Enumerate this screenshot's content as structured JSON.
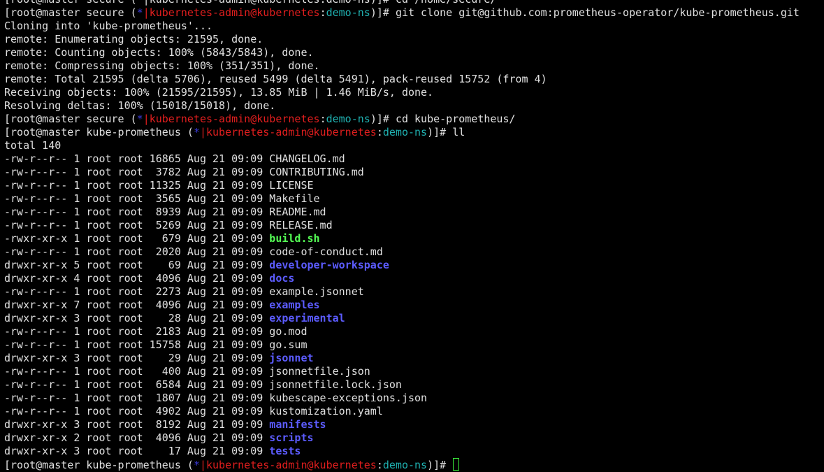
{
  "colors": {
    "background": "#000000",
    "text": "#e0e0e0",
    "prompt_marker": "#3a3ad6",
    "kube_user": "#e01e1e",
    "kube_namespace": "#1fb1b1",
    "executable": "#55ff55",
    "directory": "#5c5cff",
    "cursor": "#39e639"
  },
  "terminal": {
    "first_line_partial": "[root@master secure (*|kubernetes-admin@kubernetes:demo-ns)]# cd /home/secure/",
    "prompt_user_host": "[root@master ",
    "prompt_marker": "*",
    "prompt_kube_user": "kubernetes-admin@kubernetes",
    "prompt_namespace": "demo-ns",
    "prompt_end": ")]# ",
    "cmd_clone": {
      "dir": "secure",
      "command": "git clone git@github.com:prometheus-operator/kube-prometheus.git"
    },
    "clone_output": [
      "Cloning into 'kube-prometheus'...",
      "remote: Enumerating objects: 21595, done.",
      "remote: Counting objects: 100% (5843/5843), done.",
      "remote: Compressing objects: 100% (351/351), done.",
      "remote: Total 21595 (delta 5706), reused 5499 (delta 5491), pack-reused 15752 (from 4)",
      "Receiving objects: 100% (21595/21595), 13.85 MiB | 1.46 MiB/s, done.",
      "Resolving deltas: 100% (15018/15018), done."
    ],
    "cmd_cd": {
      "dir": "secure",
      "command": "cd kube-prometheus/"
    },
    "cmd_ll": {
      "dir": "kube-prometheus",
      "command": "ll"
    },
    "total_line": "total 140",
    "listing": [
      {
        "meta": "-rw-r--r-- 1 root root 16865 Aug 21 09:09 ",
        "name": "CHANGELOG.md",
        "kind": "file"
      },
      {
        "meta": "-rw-r--r-- 1 root root  3782 Aug 21 09:09 ",
        "name": "CONTRIBUTING.md",
        "kind": "file"
      },
      {
        "meta": "-rw-r--r-- 1 root root 11325 Aug 21 09:09 ",
        "name": "LICENSE",
        "kind": "file"
      },
      {
        "meta": "-rw-r--r-- 1 root root  3565 Aug 21 09:09 ",
        "name": "Makefile",
        "kind": "file"
      },
      {
        "meta": "-rw-r--r-- 1 root root  8939 Aug 21 09:09 ",
        "name": "README.md",
        "kind": "file"
      },
      {
        "meta": "-rw-r--r-- 1 root root  5269 Aug 21 09:09 ",
        "name": "RELEASE.md",
        "kind": "file"
      },
      {
        "meta": "-rwxr-xr-x 1 root root   679 Aug 21 09:09 ",
        "name": "build.sh",
        "kind": "exec"
      },
      {
        "meta": "-rw-r--r-- 1 root root  2020 Aug 21 09:09 ",
        "name": "code-of-conduct.md",
        "kind": "file"
      },
      {
        "meta": "drwxr-xr-x 5 root root    69 Aug 21 09:09 ",
        "name": "developer-workspace",
        "kind": "dir"
      },
      {
        "meta": "drwxr-xr-x 4 root root  4096 Aug 21 09:09 ",
        "name": "docs",
        "kind": "dir"
      },
      {
        "meta": "-rw-r--r-- 1 root root  2273 Aug 21 09:09 ",
        "name": "example.jsonnet",
        "kind": "file"
      },
      {
        "meta": "drwxr-xr-x 7 root root  4096 Aug 21 09:09 ",
        "name": "examples",
        "kind": "dir"
      },
      {
        "meta": "drwxr-xr-x 3 root root    28 Aug 21 09:09 ",
        "name": "experimental",
        "kind": "dir"
      },
      {
        "meta": "-rw-r--r-- 1 root root  2183 Aug 21 09:09 ",
        "name": "go.mod",
        "kind": "file"
      },
      {
        "meta": "-rw-r--r-- 1 root root 15758 Aug 21 09:09 ",
        "name": "go.sum",
        "kind": "file"
      },
      {
        "meta": "drwxr-xr-x 3 root root    29 Aug 21 09:09 ",
        "name": "jsonnet",
        "kind": "dir"
      },
      {
        "meta": "-rw-r--r-- 1 root root   400 Aug 21 09:09 ",
        "name": "jsonnetfile.json",
        "kind": "file"
      },
      {
        "meta": "-rw-r--r-- 1 root root  6584 Aug 21 09:09 ",
        "name": "jsonnetfile.lock.json",
        "kind": "file"
      },
      {
        "meta": "-rw-r--r-- 1 root root  1807 Aug 21 09:09 ",
        "name": "kubescape-exceptions.json",
        "kind": "file"
      },
      {
        "meta": "-rw-r--r-- 1 root root  4902 Aug 21 09:09 ",
        "name": "kustomization.yaml",
        "kind": "file"
      },
      {
        "meta": "drwxr-xr-x 3 root root  8192 Aug 21 09:09 ",
        "name": "manifests",
        "kind": "dir"
      },
      {
        "meta": "drwxr-xr-x 2 root root  4096 Aug 21 09:09 ",
        "name": "scripts",
        "kind": "dir"
      },
      {
        "meta": "drwxr-xr-x 3 root root    17 Aug 21 09:09 ",
        "name": "tests",
        "kind": "dir"
      }
    ],
    "final_prompt": {
      "dir": "kube-prometheus",
      "command": ""
    }
  }
}
